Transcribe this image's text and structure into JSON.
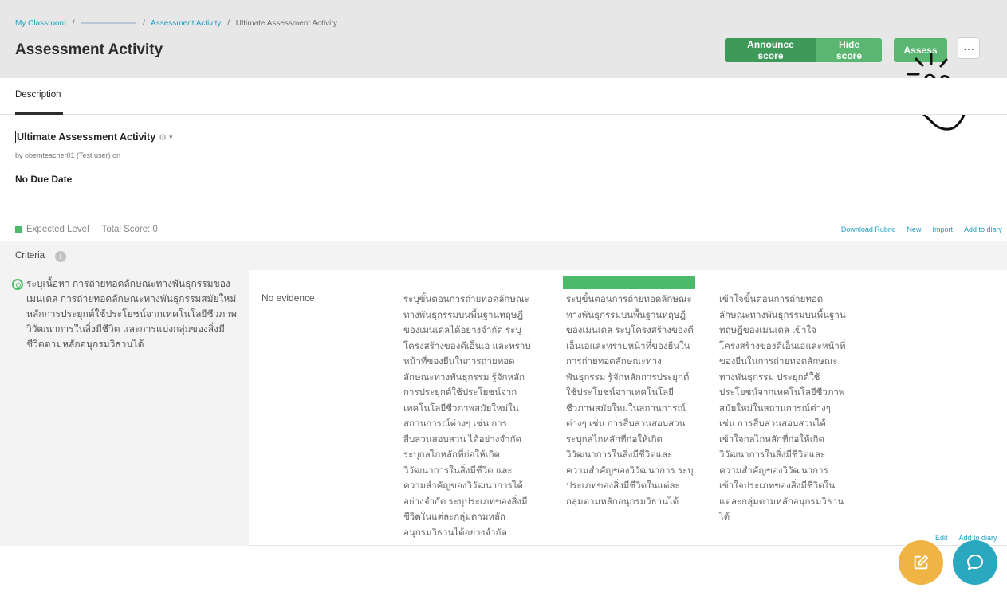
{
  "breadcrumb": {
    "items": [
      "My Classroom",
      "Assessment Activity",
      "Ultimate Assessment Activity"
    ],
    "separator": "/"
  },
  "header": {
    "title": "Assessment Activity",
    "announce_label": "Announce score",
    "hide_label": "Hide score",
    "assess_label": "Assess",
    "more_label": "···"
  },
  "tabs": {
    "description": "Description"
  },
  "activity": {
    "title": "Ultimate Assessment Activity",
    "byline": "by obemteacher01 (Test user) on",
    "due": "No Due Date"
  },
  "legend": {
    "expected": "Expected Level",
    "total": "Total Score: 0"
  },
  "links": {
    "download": "Download Rubric",
    "new": "New",
    "import": "Import",
    "add_diary": "Add to diary"
  },
  "criteria": {
    "label": "Criteria",
    "info": "i",
    "text": "ระบุเนื้อหา การถ่ายทอดลักษณะทางพันธุกรรมของเมนเดล การถ่ายทอดลักษณะทางพันธุกรรมสมัยใหม่ หลักการประยุกต์ใช้ประโยชน์จากเทคโนโลยีชีวภาพ วิวัฒนาการในสิ่งมีชีวิต และการแบ่งกลุ่มของสิ่งมีชีวิตตามหลักอนุกรมวิธานได้",
    "no_evidence": "No evidence",
    "levels": [
      "ระบุขั้นตอนการถ่ายทอดลักษณะทางพันธุกรรมบนพื้นฐานทฤษฎีของเมนเดลได้อย่างจำกัด ระบุโครงสร้างของดีเอ็นเอ และทราบหน้าที่ของยีนในการถ่ายทอดลักษณะทางพันธุกรรม รู้จักหลักการประยุกต์ใช้ประโยชน์จากเทคโนโลยีชีวภาพสมัยใหม่ในสถานการณ์ต่างๆ เช่น การสืบสวนสอบสวน ได้อย่างจำกัด ระบุกลไกหลักที่ก่อให้เกิดวิวัฒนาการในสิ่งมีชีวิต และความสำคัญของวิวัฒนาการได้อย่างจำกัด ระบุประเภทของสิ่งมีชีวิตในแต่ละกลุ่มตามหลักอนุกรมวิธานได้อย่างจำกัด",
      "ระบุขั้นตอนการถ่ายทอดลักษณะทางพันธุกรรมบนพื้นฐานทฤษฎีของเมนเดล ระบุโครงสร้างของดีเอ็นเอและทราบหน้าที่ของยีนในการถ่ายทอดลักษณะทางพันธุกรรม รู้จักหลักการประยุกต์ใช้ประโยชน์จากเทคโนโลยีชีวภาพสมัยใหม่ในสถานการณ์ต่างๆ เช่น การสืบสวนสอบสวน ระบุกลไกหลักที่ก่อให้เกิดวิวัฒนาการในสิ่งมีชีวิตและความสำคัญของวิวัฒนาการ ระบุประเภทของสิ่งมีชีวิตในแต่ละกลุ่มตามหลักอนุกรมวิธานได้",
      "เข้าใจขั้นตอนการถ่ายทอดลักษณะทางพันธุกรรมบนพื้นฐานทฤษฎีของเมนเดล เข้าใจโครงสร้างของดีเอ็นเอและหน้าที่ของยีนในการถ่ายทอดลักษณะทางพันธุกรรม ประยุกต์ใช้ประโยชน์จากเทคโนโลยีชีวภาพสมัยใหม่ในสถานการณ์ต่างๆ เช่น การสืบสวนสอบสวนได้ เข้าใจกลไกหลักที่ก่อให้เกิดวิวัฒนาการในสิ่งมีชีวิตและความสำคัญของวิวัฒนาการ เข้าใจประเภทของสิ่งมีชีวิตในแต่ละกลุ่มตามหลักอนุกรมวิธานได้"
    ],
    "edit": "Edit",
    "add_diary": "Add to diary"
  },
  "colors": {
    "green_dark": "#3f9a5a",
    "green": "#5ab671",
    "accent": "#4cba6b",
    "link": "#1f9ec2",
    "fab_edit": "#f0b445",
    "fab_chat": "#2aa8c0"
  },
  "icons": {
    "settings": "gear-icon",
    "target": "target-icon",
    "info": "info-icon",
    "edit": "pencil-note-icon",
    "chat": "chat-bubble-icon",
    "pointer": "click-hand-icon"
  }
}
